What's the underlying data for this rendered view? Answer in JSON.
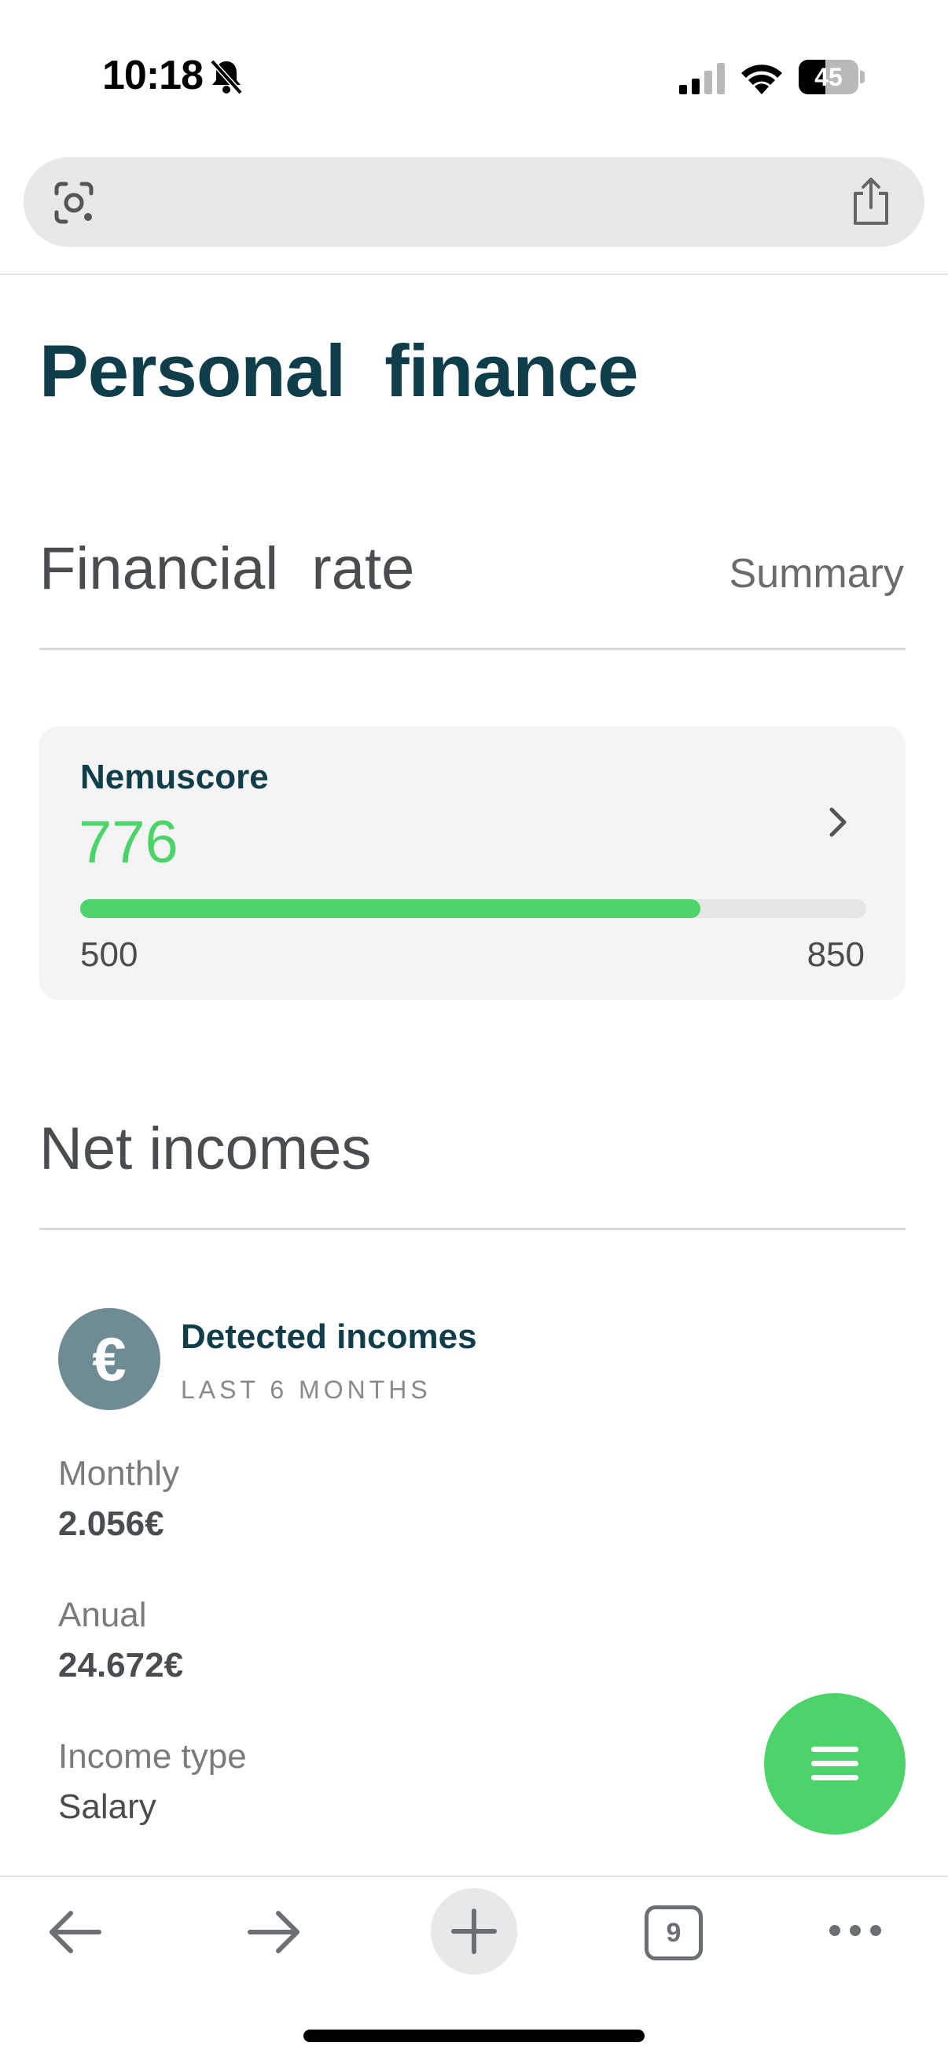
{
  "status_bar": {
    "time": "10:18",
    "battery": "45",
    "battery_level": 0.45
  },
  "icons": {
    "bell": "bell-slash-icon",
    "signal": "signal-icon",
    "wifi": "wifi-icon",
    "lens": "camera-lens-icon",
    "share": "share-icon",
    "chevron": "chevron-right-icon",
    "euro": "euro-icon",
    "menu": "menu-icon",
    "back": "arrow-left-icon",
    "forward": "arrow-right-icon",
    "new_tab": "plus-icon",
    "more": "more-dots-icon"
  },
  "page": {
    "title": "Personal  finance"
  },
  "financial_rate": {
    "title": "Financial  rate",
    "link": "Summary",
    "score_card": {
      "label": "Nemuscore",
      "value": "776",
      "min": "500",
      "max": "850",
      "score": 776,
      "range": [
        500,
        850
      ]
    }
  },
  "net_incomes": {
    "title": "Net incomes",
    "card": {
      "avatar_symbol": "€",
      "title": "Detected incomes",
      "subtitle": "LAST 6 MONTHS"
    },
    "fields": [
      {
        "label": "Monthly",
        "value": "2.056€"
      },
      {
        "label": "Anual",
        "value": "24.672€"
      },
      {
        "label": "Income type",
        "value": "Salary"
      }
    ]
  },
  "toolbar": {
    "tab_count": "9"
  },
  "colors": {
    "accent": "#4cd46a",
    "title": "#0f3e4a",
    "avatar": "#6f8c94"
  }
}
